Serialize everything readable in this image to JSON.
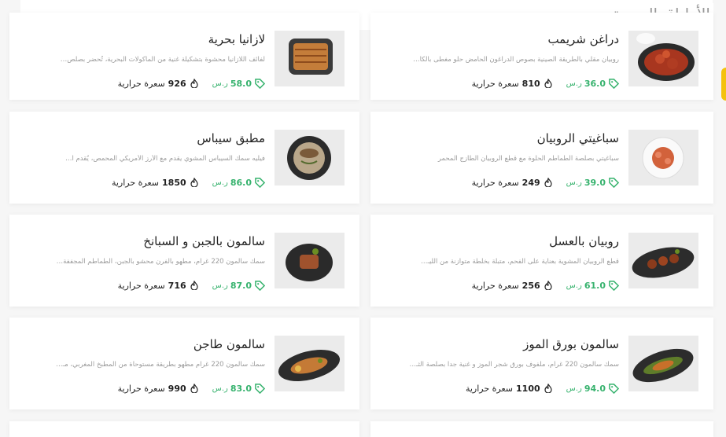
{
  "section": {
    "title": "الأطباق البحرية"
  },
  "meta_labels": {
    "currency": "ر.س",
    "calories": "سعرة حرارية"
  },
  "colors": {
    "price": "#36b26d",
    "accent_tab": "#f4c20d"
  },
  "icons": {
    "price": "price-tag-icon",
    "calories": "flame-icon"
  },
  "dishes": [
    {
      "name": "دراغن شريمب",
      "description": "روبيان مقلي بالطريقة الصينية بصوص الدراغون الحامض حلو مغطى بالكا…",
      "price": "36.0",
      "calories": "810"
    },
    {
      "name": "لازانيا بحرية",
      "description": "لفائف اللازانيا محشوة بتشكيلة غنية من المأكولات البحرية، تُحضر بصلص…",
      "price": "58.0",
      "calories": "926"
    },
    {
      "name": "سباغيتي الروبيان",
      "description": "سباغيتي بصلصة الطماطم الحلوة مع قطع الروبيان الطازج المحمر",
      "price": "39.0",
      "calories": "249"
    },
    {
      "name": "مطبق سيباس",
      "description": "فيليه سمك السيباس المشوي يقدم مع الأرز الأمريكي المحمص، يُقدم ا…",
      "price": "86.0",
      "calories": "1850"
    },
    {
      "name": "روبيان بالعسل",
      "description": "قطع الروبيان المشوية بعناية على الفحم، متبلة بخلطة متوازنة من الليـ…",
      "price": "61.0",
      "calories": "256"
    },
    {
      "name": "سالمون بالجبن و السبانخ",
      "description": "سمك سالمون 220 غرام، مطهو بالفرن محشو بالجبن، الطماطم المجففة…",
      "price": "87.0",
      "calories": "716"
    },
    {
      "name": "سالمون بورق الموز",
      "description": "سمك سالمون 220 غرام، ملفوف بورق شجر الموز و غنية جداً بصلصة الثـ…",
      "price": "94.0",
      "calories": "1100"
    },
    {
      "name": "سالمون طاجن",
      "description": "سمك سالمون 220 غرام مطهو بطريقة مستوحاة من المطبخ المغربي، مـ…",
      "price": "83.0",
      "calories": "990"
    }
  ]
}
